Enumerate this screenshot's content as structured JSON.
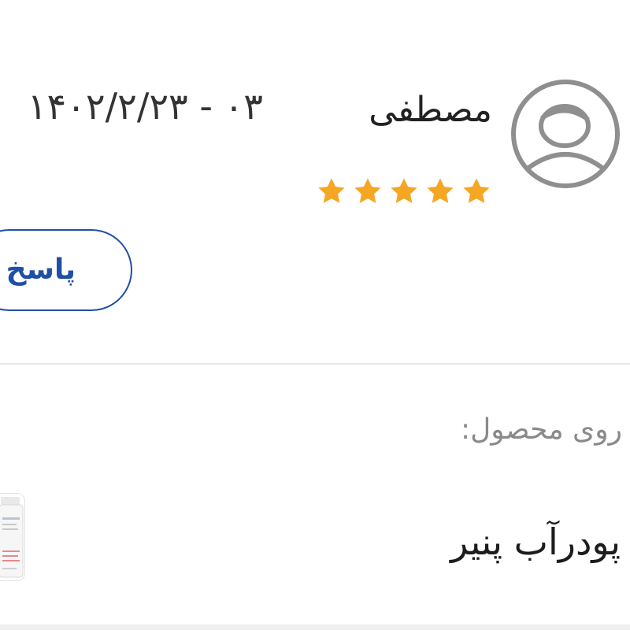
{
  "review": {
    "user_name": "مصطفی",
    "avatar_icon": "user-avatar-icon",
    "rating": 5,
    "rating_max": 5,
    "star_color": "#f5a623",
    "date": "۱۴۰۲/۲/۲۳ - ۰۳",
    "reply_label": "پاسخ"
  },
  "product": {
    "on_product_label": "روی محصول:",
    "name": "پودرآب پنیر",
    "thumbnail_icon": "product-bottle-icon"
  },
  "colors": {
    "accent": "#1f4fa6",
    "text_primary": "#222222",
    "text_secondary": "#8a8a8a",
    "divider": "#e6e6e6"
  }
}
